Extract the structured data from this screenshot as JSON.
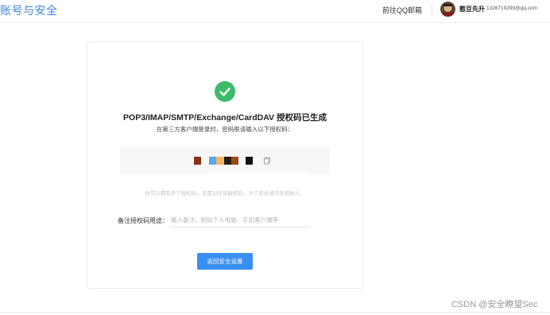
{
  "header": {
    "title": "账号与安全",
    "qq_mail_link": "前往QQ邮箱",
    "user_name": "憨豆先升",
    "user_email": "· 1326719299@qq.com"
  },
  "card": {
    "title": "POP3/IMAP/SMTP/Exchange/CardDAV 授权码已生成",
    "subtitle": "在第三方客户端登录时，密码框请输入以下授权码：",
    "code_blocks": [
      {
        "color": "#8b2e12"
      },
      {
        "color": "#5aa8f0"
      },
      {
        "color": "#f2b560"
      },
      {
        "color": "#2a1a10"
      },
      {
        "color": "#9a4a1a"
      },
      {
        "color": "#111111"
      }
    ],
    "hint": "你可以拥有多个授权码，无需记住该授权码。为了安全请勿告知他人。",
    "remark_label": "备注授权码用途：",
    "remark_placeholder": "输入备注，例如个人电脑、手机客户端等",
    "return_button": "返回安全设置"
  },
  "watermark": "CSDN @安全瞭望Sec",
  "colors": {
    "accent": "#3a8ff5",
    "success": "#3dbb6b",
    "title_blue": "#3d86d8"
  }
}
